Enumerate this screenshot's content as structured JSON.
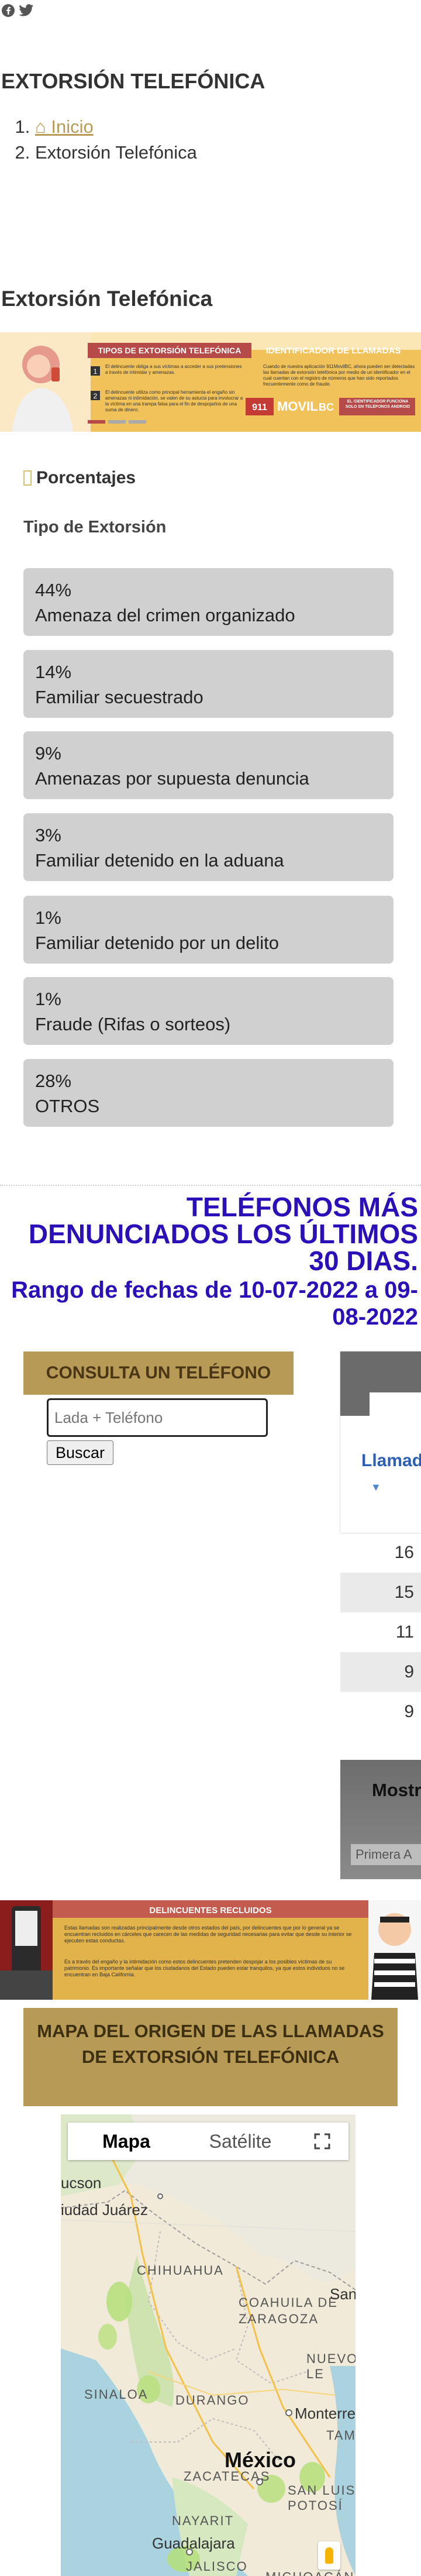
{
  "social": {
    "facebook_icon": "facebook-icon",
    "twitter_icon": "twitter-icon"
  },
  "page_title": "EXTORSIÓN TELEFÓNICA",
  "breadcrumb": {
    "home_label": "Inicio",
    "current": "Extorsión Telefónica"
  },
  "section_title": "Extorsión Telefónica",
  "banner1": {
    "left_title": "TIPOS DE EXTORSIÓN TELEFÓNICA",
    "right_title": "IDENTIFICADOR DE LLAMADAS",
    "step1": "El delincuente obliga a sus víctimas a acceder a sus pretensiones a través de intimidar y amenazas.",
    "step2": "El delincuente utiliza como principal herramienta el engaño sin amenazas ni intimidación, se valen de su astucia para involucrar a la víctima en una trampa falsa para el fin de despojarlos de una suma de dinero.",
    "right_text": "Cuando de nuestra aplicación 911MovilBC, ahora pueden ser detectadas las llamadas de extorsión telefónica por medio de un identificador en el cual cuentan con el registro de números que han sido reportados frecuentemente como de fraude.",
    "app_name": "MOVIL",
    "app_suffix": "BC",
    "app_badge": "911",
    "right_footer": "EL IDENTIFICADOR FUNCIONA SOLO EN TELÉFONOS ANDROID"
  },
  "percent": {
    "heading": "Porcentajes",
    "subheading": "Tipo de Extorsión",
    "items": [
      {
        "pct": "44%",
        "label": "Amenaza del crimen organizado"
      },
      {
        "pct": "14%",
        "label": "Familiar secuestrado"
      },
      {
        "pct": "9%",
        "label": "Amenazas por supuesta denuncia"
      },
      {
        "pct": "3%",
        "label": "Familiar detenido en la aduana"
      },
      {
        "pct": "1%",
        "label": "Familiar detenido por un delito"
      },
      {
        "pct": "1%",
        "label": "Fraude (Rifas o sorteos)"
      },
      {
        "pct": "28%",
        "label": "OTROS"
      }
    ]
  },
  "telefonos": {
    "title": "TELÉFONOS MÁS DENUNCIADOS LOS ÚLTIMOS 30 DIAS.",
    "range": "Rango de fechas de 10-07-2022 a 09-08-2022"
  },
  "consulta": {
    "title": "CONSULTA UN TELÉFONO",
    "placeholder": "Lada + Teléfono",
    "button": "Buscar"
  },
  "table": {
    "column": "Llamad",
    "rows": [
      "16",
      "15",
      "11",
      "9",
      "9"
    ],
    "footer_show": "Mostr",
    "pag_first": "Primera",
    "pag_prev": "A"
  },
  "banner2": {
    "title": "DELINCUENTES RECLUIDOS",
    "text1": "Estas llamadas son realizadas principalmente desde otros estados del país, por delincuentes que por lo general ya se encuentran recluidos en cárceles que carecen de las medidas de seguridad necesarias para evitar que desde su interior se ejecuten estas conductas.",
    "text2": "Es a través del engaño y la intimidación como estos delincuentes pretenden despojar a los posibles víctimas de su patrimonio. Es importante señalar que los ciudadanos del Estado pueden estar tranquilos, ya que estos individuos no se encuentran en Baja California."
  },
  "mapa": {
    "title": "MAPA DEL ORIGEN DE LAS LLAMADAS DE EXTORSIÓN TELEFÓNICA",
    "tab_map": "Mapa",
    "tab_sat": "Satélite",
    "labels": {
      "tucson": "ucson",
      "juarez": "iudad Juárez",
      "chihuahua": "CHIHUAHUA",
      "coahuila": "COAHUILA DE\nZARAGOZA",
      "nuevo_leon": "NUEVO LE",
      "san": "San",
      "sinaloa": "SINALOA",
      "durango": "DURANGO",
      "monterrey": "Monterrey",
      "tamau": "TAMA",
      "mexico": "México",
      "zacatecas": "ZACATECAS",
      "san_luis": "SAN LUIS\nPOTOSÍ",
      "nayarit": "NAYARIT",
      "guadalajara": "Guadalajara",
      "jalisco": "JALISCO",
      "michoacan": "MICHOACÁN"
    }
  },
  "colors": {
    "gold": "#b79a56",
    "heading_blue": "#2b0fb8",
    "stat_bg": "#d0d0d0"
  }
}
